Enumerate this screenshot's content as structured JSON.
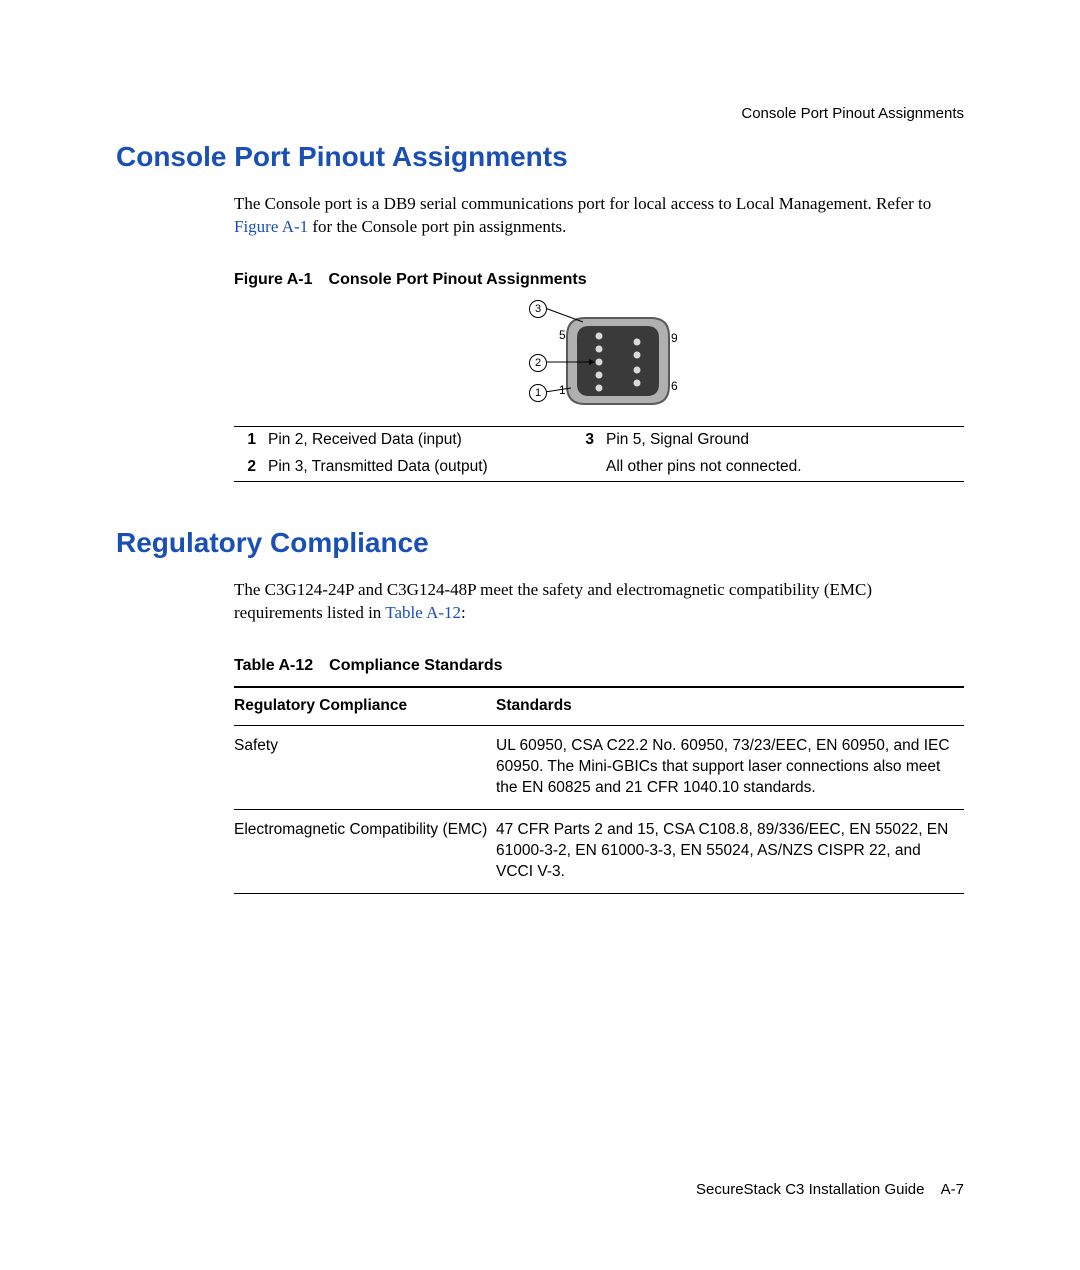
{
  "running_head": "Console Port Pinout Assignments",
  "section1": {
    "title": "Console Port Pinout Assignments",
    "para_pre": "The Console port is a DB9 serial communications port for local access to Local Management. Refer to ",
    "para_link": "Figure A-1",
    "para_post": " for the Console port pin assignments.",
    "figure": {
      "num": "Figure A-1",
      "title": "Console Port Pinout Assignments",
      "callouts": {
        "c1": "1",
        "c2": "2",
        "c3": "3"
      },
      "pin_labels": {
        "p5": "5",
        "p9": "9",
        "p1": "1",
        "p6": "6"
      },
      "legend": [
        {
          "idx": "1",
          "txt": "Pin 2, Received Data (input)"
        },
        {
          "idx": "2",
          "txt": "Pin 3, Transmitted Data (output)"
        },
        {
          "idx": "3",
          "txt": "Pin 5, Signal Ground"
        },
        {
          "idx": "",
          "txt": "All other pins not connected."
        }
      ]
    }
  },
  "section2": {
    "title": "Regulatory Compliance",
    "para_pre": "The C3G124-24P and C3G124-48P meet the safety and electromagnetic compatibility (EMC) requirements listed in ",
    "para_link": "Table A-12",
    "para_post": ":",
    "table": {
      "num": "Table A-12",
      "title": "Compliance Standards",
      "head1": "Regulatory Compliance",
      "head2": "Standards",
      "rows": [
        {
          "c1": "Safety",
          "c2": "UL 60950, CSA C22.2 No. 60950, 73/23/EEC, EN 60950, and IEC 60950. The Mini-GBICs that support laser connections also meet the EN 60825 and 21 CFR 1040.10 standards."
        },
        {
          "c1": "Electromagnetic Compatibility (EMC)",
          "c2": "47 CFR Parts 2 and 15, CSA C108.8, 89/336/EEC, EN 55022, EN 61000-3-2, EN 61000-3-3, EN 55024, AS/NZS CISPR 22, and VCCI V-3."
        }
      ]
    }
  },
  "footer": {
    "book": "SecureStack C3 Installation Guide",
    "page": "A-7"
  }
}
